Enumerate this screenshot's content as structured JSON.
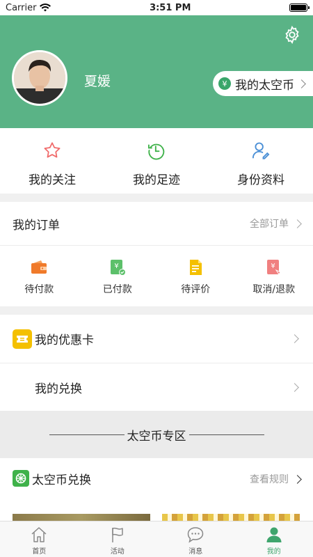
{
  "status_bar": {
    "carrier": "Carrier",
    "time": "3:51 PM"
  },
  "profile": {
    "username": "夏媛",
    "coin_button": "我的太空币"
  },
  "quick_links": [
    {
      "label": "我的关注",
      "icon": "star-icon"
    },
    {
      "label": "我的足迹",
      "icon": "history-clock-icon"
    },
    {
      "label": "身份资料",
      "icon": "user-edit-icon"
    }
  ],
  "orders": {
    "title": "我的订单",
    "all_orders": "全部订单",
    "statuses": [
      {
        "label": "待付款",
        "icon": "wallet-icon"
      },
      {
        "label": "已付款",
        "icon": "paid-yen-icon"
      },
      {
        "label": "待评价",
        "icon": "review-doc-icon"
      },
      {
        "label": "取消/退款",
        "icon": "refund-yen-icon"
      }
    ]
  },
  "cards": {
    "coupon": "我的优惠卡",
    "redeem": "我的兑换"
  },
  "zone": {
    "title": "太空币专区"
  },
  "exchange": {
    "title": "太空币兑换",
    "rules": "查看规则"
  },
  "tabs": [
    {
      "label": "首页",
      "icon": "home-icon"
    },
    {
      "label": "活动",
      "icon": "flag-icon"
    },
    {
      "label": "消息",
      "icon": "message-icon"
    },
    {
      "label": "我的",
      "icon": "user-icon",
      "active": true
    }
  ],
  "colors": {
    "brand_green": "#5ab386",
    "active_tab": "#3fa56d"
  }
}
